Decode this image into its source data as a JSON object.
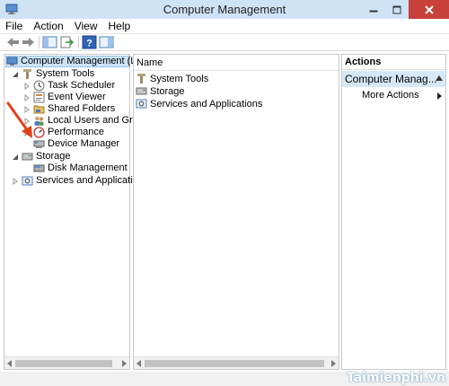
{
  "window": {
    "title": "Computer Management",
    "accent_color": "#cfe3f7",
    "close_color": "#c7403a"
  },
  "menu": {
    "items": [
      "File",
      "Action",
      "View",
      "Help"
    ]
  },
  "toolbar": {
    "icons": [
      "back-arrow-icon",
      "forward-arrow-icon",
      "show-hide-console-tree-icon",
      "export-list-icon",
      "help-icon",
      "action-pane-icon"
    ]
  },
  "tree": {
    "root": "Computer Management (Local",
    "system_tools": "System Tools",
    "task_scheduler": "Task Scheduler",
    "event_viewer": "Event Viewer",
    "shared_folders": "Shared Folders",
    "local_users": "Local Users and Groups",
    "performance": "Performance",
    "device_manager": "Device Manager",
    "storage": "Storage",
    "disk_management": "Disk Management",
    "services": "Services and Applications"
  },
  "list": {
    "column_name": "Name",
    "items": [
      "System Tools",
      "Storage",
      "Services and Applications"
    ]
  },
  "actions": {
    "header": "Actions",
    "group": "Computer Manag...",
    "more": "More Actions"
  },
  "watermark": "Taimienphi.vn"
}
